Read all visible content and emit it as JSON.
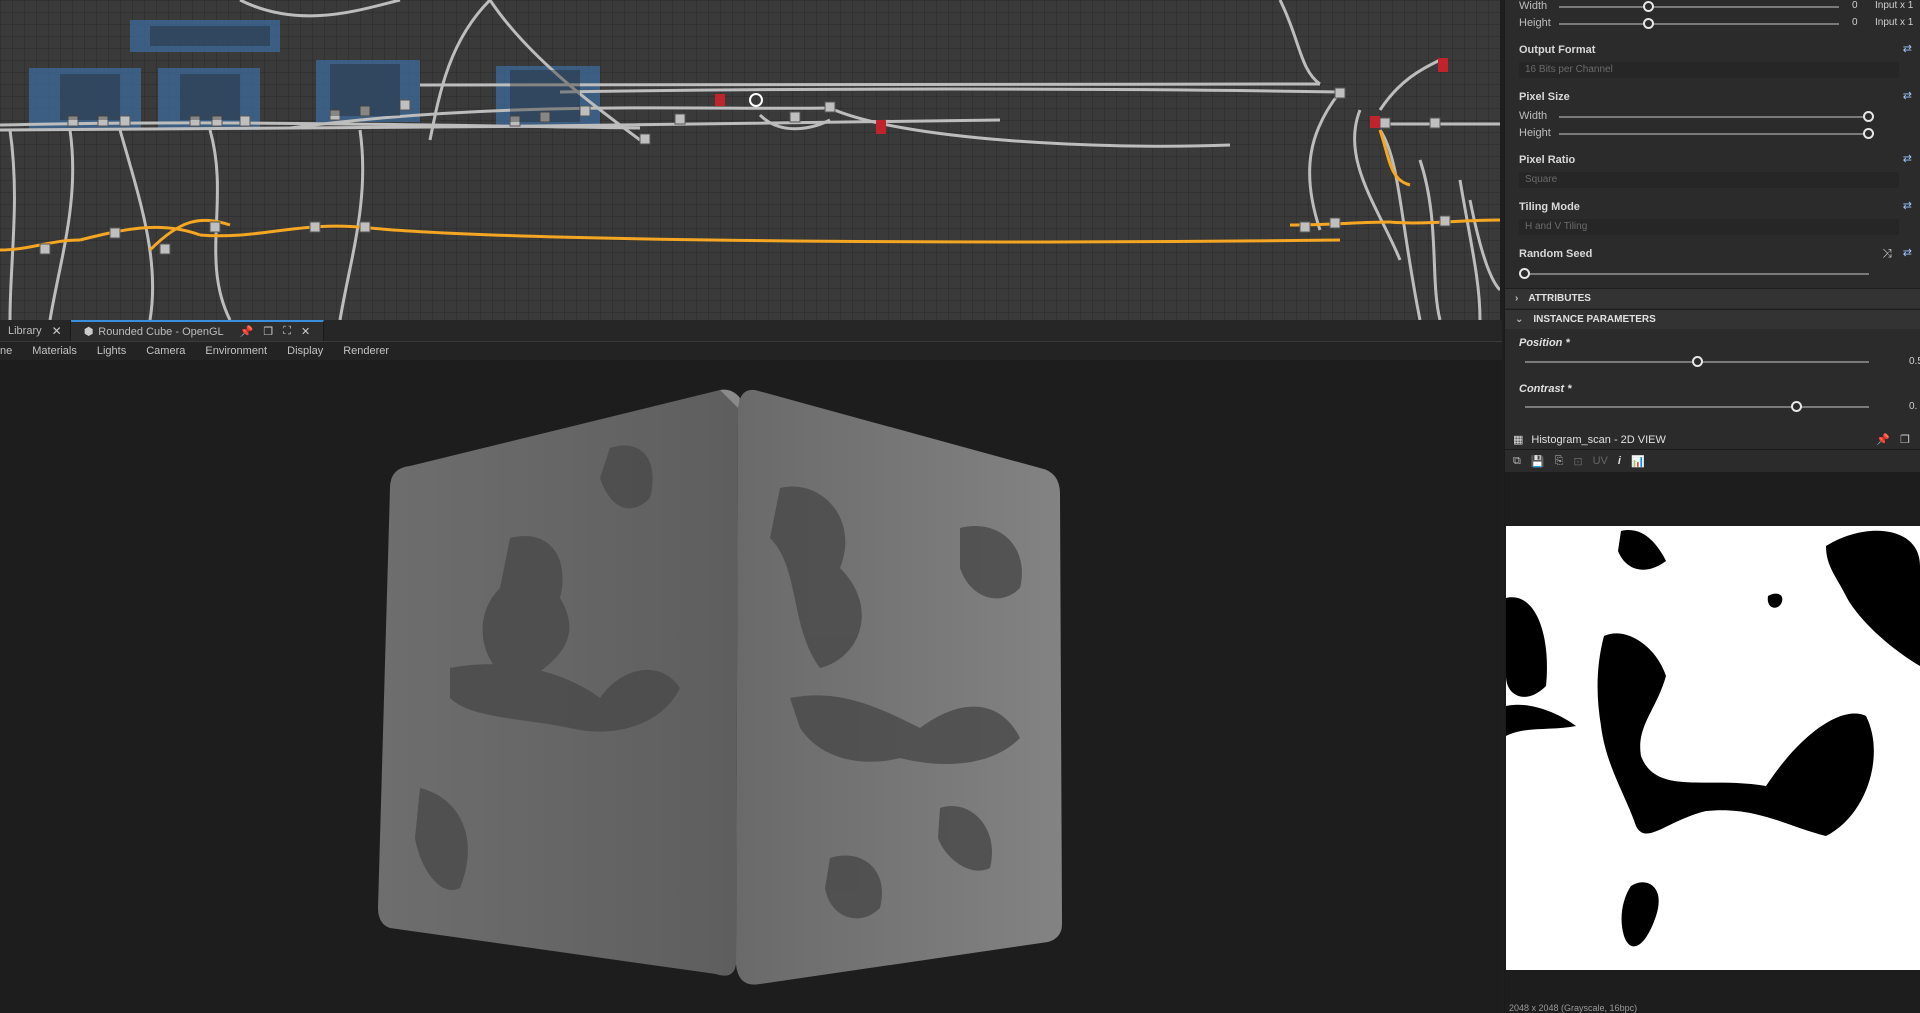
{
  "viewport": {
    "tabs": [
      {
        "label": "Library",
        "active": false,
        "icon": "close-icon"
      },
      {
        "label": "Rounded Cube - OpenGL",
        "active": true,
        "icon": "cube-icon"
      }
    ],
    "menu": [
      "ne",
      "Materials",
      "Lights",
      "Camera",
      "Environment",
      "Display",
      "Renderer"
    ]
  },
  "panel": {
    "top_rows": [
      {
        "label": "Width",
        "value": "0",
        "suffix": "Input x 1",
        "fraction": 0.5
      },
      {
        "label": "Height",
        "value": "0",
        "suffix": "Input x 1",
        "fraction": 0.5
      }
    ],
    "output_format": {
      "label": "Output Format",
      "value": "16 Bits per Channel"
    },
    "pixel_size": {
      "label": "Pixel Size",
      "width_label": "Width",
      "height_label": "Height",
      "width_fraction": 1.0,
      "height_fraction": 1.0
    },
    "pixel_ratio": {
      "label": "Pixel Ratio",
      "value": "Square"
    },
    "tiling_mode": {
      "label": "Tiling Mode",
      "value": "H and V Tiling"
    },
    "random_seed": {
      "label": "Random Seed",
      "fraction": 0.0
    },
    "sections": {
      "attributes": "ATTRIBUTES",
      "instance": "INSTANCE PARAMETERS"
    },
    "position": {
      "label": "Position *",
      "value": "0.5",
      "fraction": 0.5
    },
    "contrast": {
      "label": "Contrast *",
      "value": "0.",
      "fraction": 0.79
    }
  },
  "view2d": {
    "title": "Histogram_scan - 2D VIEW",
    "toolbar_uv": "UV",
    "toolbar_info": "i",
    "status": "2048 x 2048 (Grayscale, 16bpc)"
  },
  "colors": {
    "accent": "#3b8edb",
    "wire": "#bdbdbd",
    "wire_active": "#f5a623",
    "frame": "#3d6b9c"
  }
}
